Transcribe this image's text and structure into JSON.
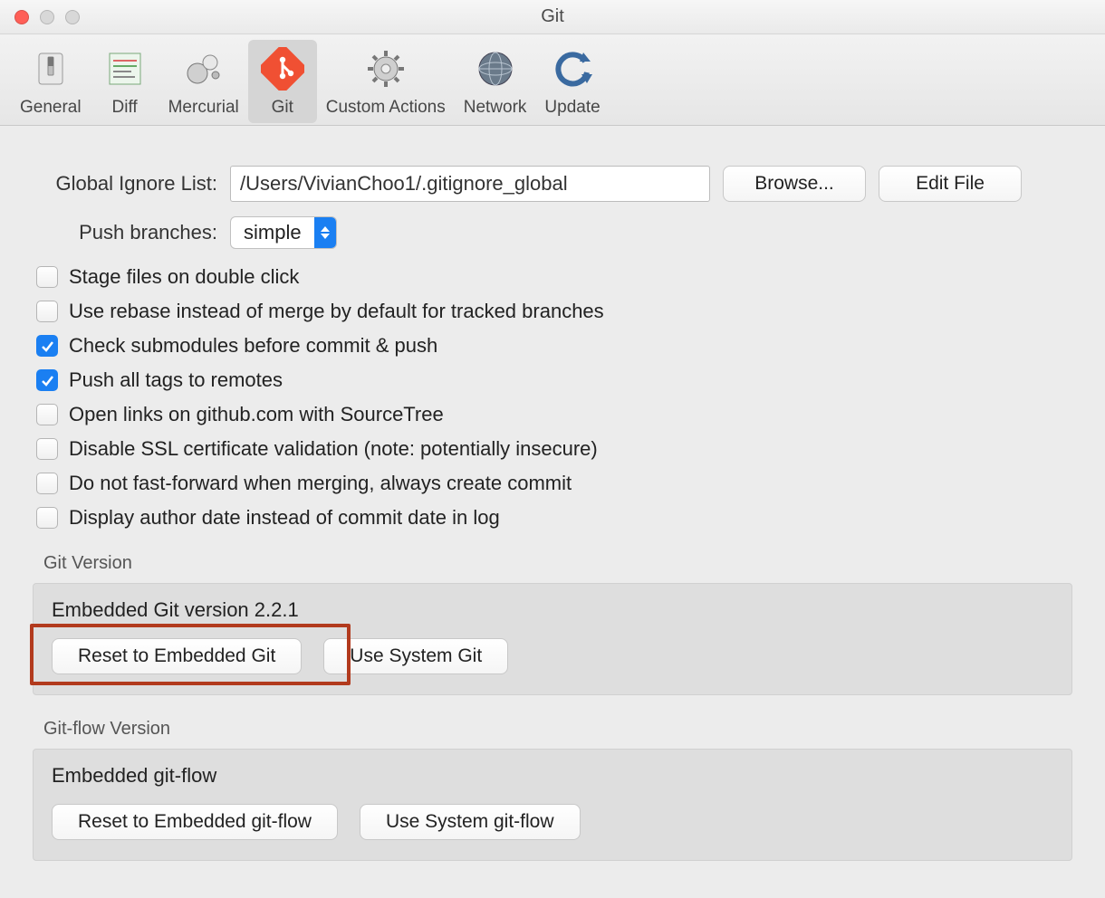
{
  "window": {
    "title": "Git"
  },
  "toolbar": {
    "items": [
      {
        "label": "General"
      },
      {
        "label": "Diff"
      },
      {
        "label": "Mercurial"
      },
      {
        "label": "Git"
      },
      {
        "label": "Custom Actions"
      },
      {
        "label": "Network"
      },
      {
        "label": "Update"
      }
    ]
  },
  "form": {
    "ignore_label": "Global Ignore List:",
    "ignore_value": "/Users/VivianChoo1/.gitignore_global",
    "browse_label": "Browse...",
    "edit_label": "Edit File",
    "push_label": "Push branches:",
    "push_value": "simple"
  },
  "checks": [
    {
      "label": "Stage files on double click",
      "checked": false
    },
    {
      "label": "Use rebase instead of merge by default for tracked branches",
      "checked": false
    },
    {
      "label": "Check submodules before commit & push",
      "checked": true
    },
    {
      "label": "Push all tags to remotes",
      "checked": true
    },
    {
      "label": "Open links on github.com with SourceTree",
      "checked": false
    },
    {
      "label": "Disable SSL certificate validation (note: potentially insecure)",
      "checked": false
    },
    {
      "label": "Do not fast-forward when merging, always create commit",
      "checked": false
    },
    {
      "label": "Display author date instead of commit date in log",
      "checked": false
    }
  ],
  "git_version": {
    "section_label": "Git Version",
    "title": "Embedded Git version 2.2.1",
    "reset_label": "Reset to Embedded Git",
    "system_label": "Use System Git"
  },
  "gitflow_version": {
    "section_label": "Git-flow Version",
    "title": "Embedded git-flow",
    "reset_label": "Reset to Embedded git-flow",
    "system_label": "Use System git-flow"
  }
}
